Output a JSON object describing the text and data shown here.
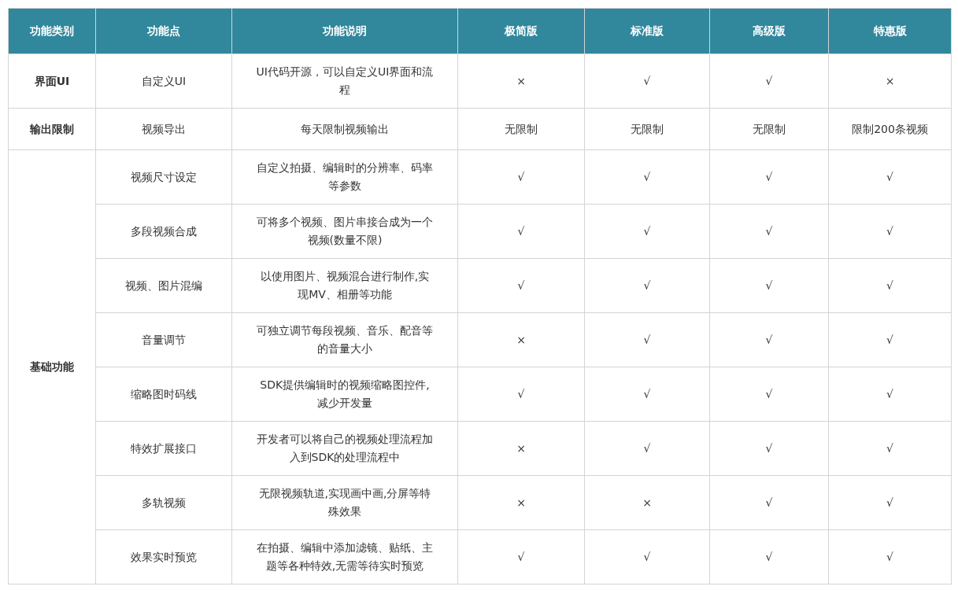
{
  "table": {
    "columns": [
      "功能类别",
      "功能点",
      "功能说明",
      "极简版",
      "标准版",
      "高级版",
      "特惠版"
    ],
    "groups": [
      {
        "category": "界面UI",
        "features": [
          {
            "name": "自定义UI",
            "description": "UI代码开源，可以自定义UI界面和流程",
            "values": [
              "×",
              "√",
              "√",
              "×"
            ]
          }
        ]
      },
      {
        "category": "输出限制",
        "features": [
          {
            "name": "视频导出",
            "description": "每天限制视频输出",
            "values": [
              "无限制",
              "无限制",
              "无限制",
              "限制200条视频"
            ]
          }
        ]
      },
      {
        "category": "基础功能",
        "features": [
          {
            "name": "视频尺寸设定",
            "description": "自定义拍摄、编辑时的分辨率、码率等参数",
            "values": [
              "√",
              "√",
              "√",
              "√"
            ]
          },
          {
            "name": "多段视频合成",
            "description": "可将多个视频、图片串接合成为一个视频(数量不限)",
            "values": [
              "√",
              "√",
              "√",
              "√"
            ]
          },
          {
            "name": "视频、图片混编",
            "description": "以使用图片、视频混合进行制作,实现MV、相册等功能",
            "values": [
              "√",
              "√",
              "√",
              "√"
            ]
          },
          {
            "name": "音量调节",
            "description": "可独立调节每段视频、音乐、配音等的音量大小",
            "values": [
              "×",
              "√",
              "√",
              "√"
            ]
          },
          {
            "name": "缩略图时码线",
            "description": "SDK提供编辑时的视频缩略图控件,减少开发量",
            "values": [
              "√",
              "√",
              "√",
              "√"
            ]
          },
          {
            "name": "特效扩展接口",
            "description": "开发者可以将自己的视频处理流程加入到SDK的处理流程中",
            "values": [
              "×",
              "√",
              "√",
              "√"
            ]
          },
          {
            "name": "多轨视频",
            "description": "无限视频轨道,实现画中画,分屏等特殊效果",
            "values": [
              "×",
              "×",
              "√",
              "√"
            ]
          },
          {
            "name": "效果实时预览",
            "description": "在拍摄、编辑中添加滤镜、贴纸、主题等各种特效,无需等待实时预览",
            "values": [
              "√",
              "√",
              "√",
              "√"
            ]
          }
        ]
      }
    ]
  }
}
